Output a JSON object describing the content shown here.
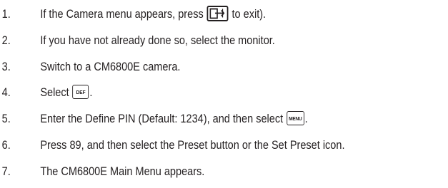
{
  "steps": [
    {
      "num": "1.",
      "before": "If the Camera menu appears, press",
      "key_icon": "exit-icon",
      "after": "to exit)."
    },
    {
      "num": "2.",
      "text": "If you have not already done so, select the monitor."
    },
    {
      "num": "3.",
      "text": "Switch to a CM6800E camera."
    },
    {
      "num": "4.",
      "before": "Select",
      "key": "DEF",
      "after": "."
    },
    {
      "num": "5.",
      "before": "Enter the Define PIN (Default: 1234), and then select",
      "key": "MENU",
      "after": "."
    },
    {
      "num": "6.",
      "text": "Press 89, and then select the Preset button or the Set Preset icon."
    },
    {
      "num": "7.",
      "text": "The CM6800E Main Menu appears."
    }
  ]
}
